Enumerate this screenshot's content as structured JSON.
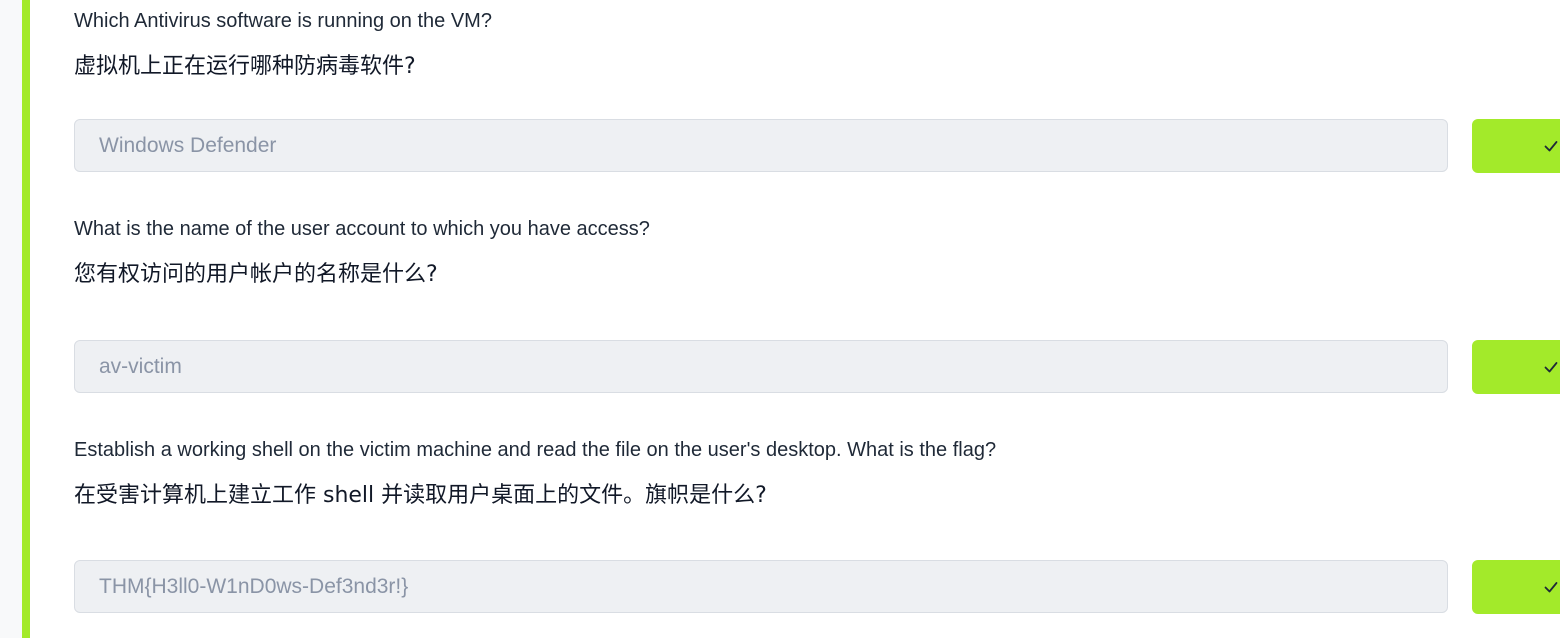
{
  "questions": [
    {
      "text_en": "Which Antivirus software is running on the VM?",
      "text_zh": "虚拟机上正在运行哪种防病毒软件?",
      "answer": "Windows Defender"
    },
    {
      "text_en": "What is the name of the user account to which you have access?",
      "text_zh": "您有权访问的用户帐户的名称是什么?",
      "answer": "av-victim"
    },
    {
      "text_en": "Establish a working shell on the victim machine and read the file on the user's desktop. What is the flag?",
      "text_zh": "在受害计算机上建立工作 shell 并读取用户桌面上的文件。旗帜是什么?",
      "answer": "THM{H3ll0-W1nD0ws-Def3nd3r!}"
    }
  ],
  "colors": {
    "accent": "#a3ea2a",
    "input_bg": "#eef0f3",
    "answer_text": "#8a94a6"
  },
  "icons": {
    "submit": "check-icon"
  }
}
